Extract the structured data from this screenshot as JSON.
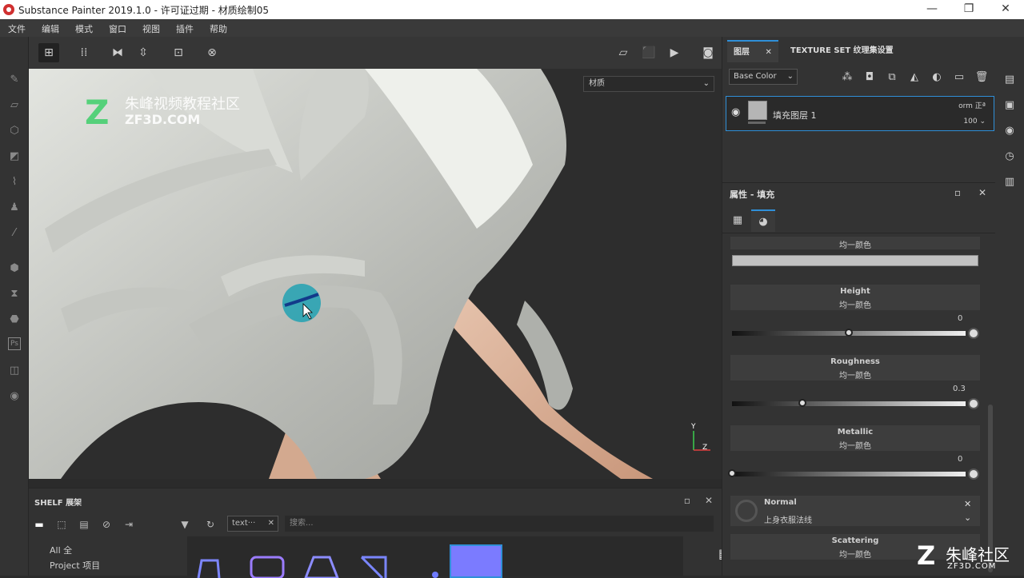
{
  "window": {
    "title": "Substance Painter 2019.1.0 - 许可证过期 - 材质绘制05",
    "minimize": "—",
    "maximize": "❐",
    "close": "✕"
  },
  "menu": [
    "文件",
    "编辑",
    "模式",
    "窗口",
    "视图",
    "插件",
    "帮助"
  ],
  "viewport": {
    "material_mode": "材质",
    "axis_y": "Y",
    "axis_z": "Z"
  },
  "watermark_top": {
    "logo": "Z",
    "name": "朱峰视频教程社区",
    "site": "ZF3D.COM"
  },
  "shelf": {
    "title": "SHELF 展架",
    "categories": [
      "All 全",
      "Project 项目"
    ],
    "filter_tag": "text···",
    "search_placeholder": "搜索..."
  },
  "layers": {
    "tabs": [
      "图层",
      "TEXTURE SET 纹理集设置"
    ],
    "channel": "Base Color",
    "layer": {
      "name": "填充图层 1",
      "blend": "orm 正ª",
      "opacity": "100"
    }
  },
  "properties": {
    "title": "属性 - 填充",
    "blocks": [
      {
        "name": "",
        "mode": "均一颜色"
      },
      {
        "name": "Height",
        "mode": "均一颜色",
        "value": "0",
        "level": 0.5
      },
      {
        "name": "Roughness",
        "mode": "均一颜色",
        "value": "0.3",
        "level": 0.3
      },
      {
        "name": "Metallic",
        "mode": "均一颜色",
        "value": "0",
        "level": 0
      },
      {
        "name": "Normal",
        "mode": "上身衣服法线"
      },
      {
        "name": "Scattering",
        "mode": "均一颜色"
      }
    ]
  },
  "watermark_bottom": {
    "logo": "Z",
    "name": "朱峰社区",
    "site": "ZF3D.COM"
  }
}
